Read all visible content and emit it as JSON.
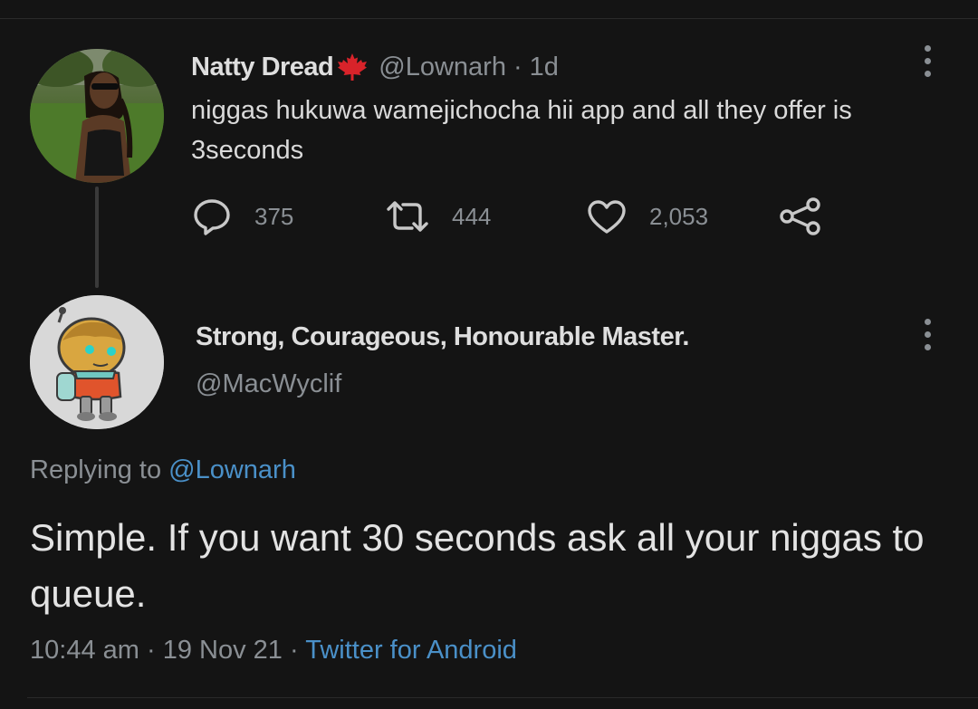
{
  "tweet": {
    "display_name": "Natty Dread",
    "flag_icon": "maple-leaf-icon",
    "handle": "@Lownarh",
    "separator": "·",
    "age": "1d",
    "text": "niggas hukuwa wamejichocha hii app and all they offer is 3seconds",
    "stats": {
      "replies": "375",
      "retweets": "444",
      "likes": "2,053"
    }
  },
  "reply": {
    "display_name": "Strong, Courageous, Honourable Master.",
    "handle": "@MacWyclif",
    "replying_prefix": "Replying to",
    "replying_handle": "@Lownarh",
    "text": "Simple. If you want 30 seconds ask all your niggas to queue.",
    "time": "10:44 am",
    "sep1": "·",
    "date": "19 Nov 21",
    "sep2": "·",
    "source": "Twitter for Android"
  },
  "colors": {
    "background": "#141414",
    "text_primary": "#dedede",
    "text_secondary": "#8a8f94",
    "link": "#4a90c8",
    "flag_red": "#d8232a"
  }
}
